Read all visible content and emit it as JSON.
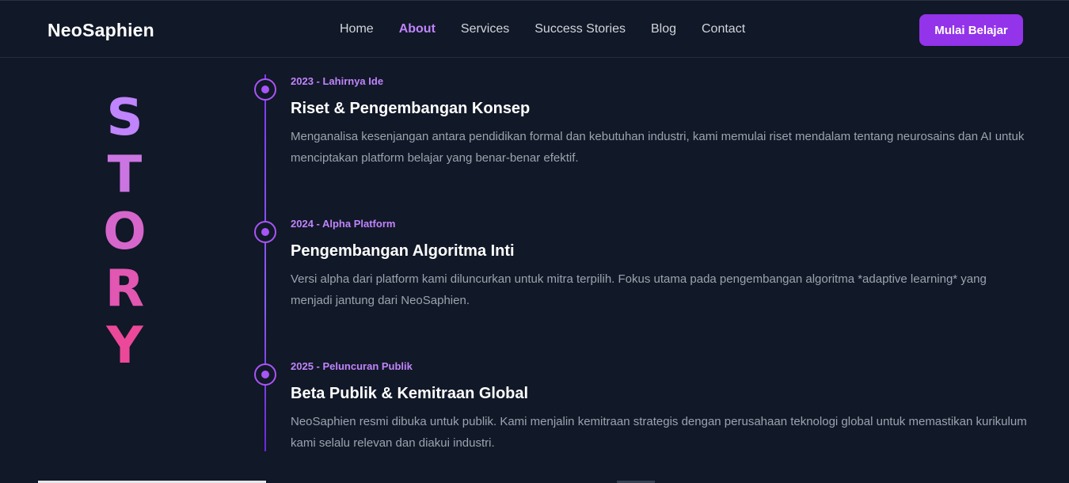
{
  "header": {
    "brand": "NeoSaphien",
    "nav": [
      "Home",
      "About",
      "Services",
      "Success Stories",
      "Blog",
      "Contact"
    ],
    "active_nav": "About",
    "cta_label": "Mulai Belajar"
  },
  "story": {
    "letters": [
      "S",
      "T",
      "O",
      "R",
      "Y"
    ],
    "gradient_start": "#c084fc",
    "gradient_end": "#ec4899"
  },
  "timeline": [
    {
      "tag": "2023 - Lahirnya Ide",
      "title": "Riset & Pengembangan Konsep",
      "description": "Menganalisa kesenjangan antara pendidikan formal dan kebutuhan industri, kami memulai riset mendalam tentang neurosains dan AI untuk menciptakan platform belajar yang benar-benar efektif."
    },
    {
      "tag": "2024 - Alpha Platform",
      "title": "Pengembangan Algoritma Inti",
      "description": "Versi alpha dari platform kami diluncurkan untuk mitra terpilih. Fokus utama pada pengembangan algoritma *adaptive learning* yang menjadi jantung dari NeoSaphien."
    },
    {
      "tag": "2025 - Peluncuran Publik",
      "title": "Beta Publik & Kemitraan Global",
      "description": "NeoSaphien resmi dibuka untuk publik. Kami menjalin kemitraan strategis dengan perusahaan teknologi global untuk memastikan kurikulum kami selalu relevan dan diakui industri."
    }
  ],
  "colors": {
    "background": "#111827",
    "accent": "#9333ea",
    "accent_light": "#c084fc"
  }
}
